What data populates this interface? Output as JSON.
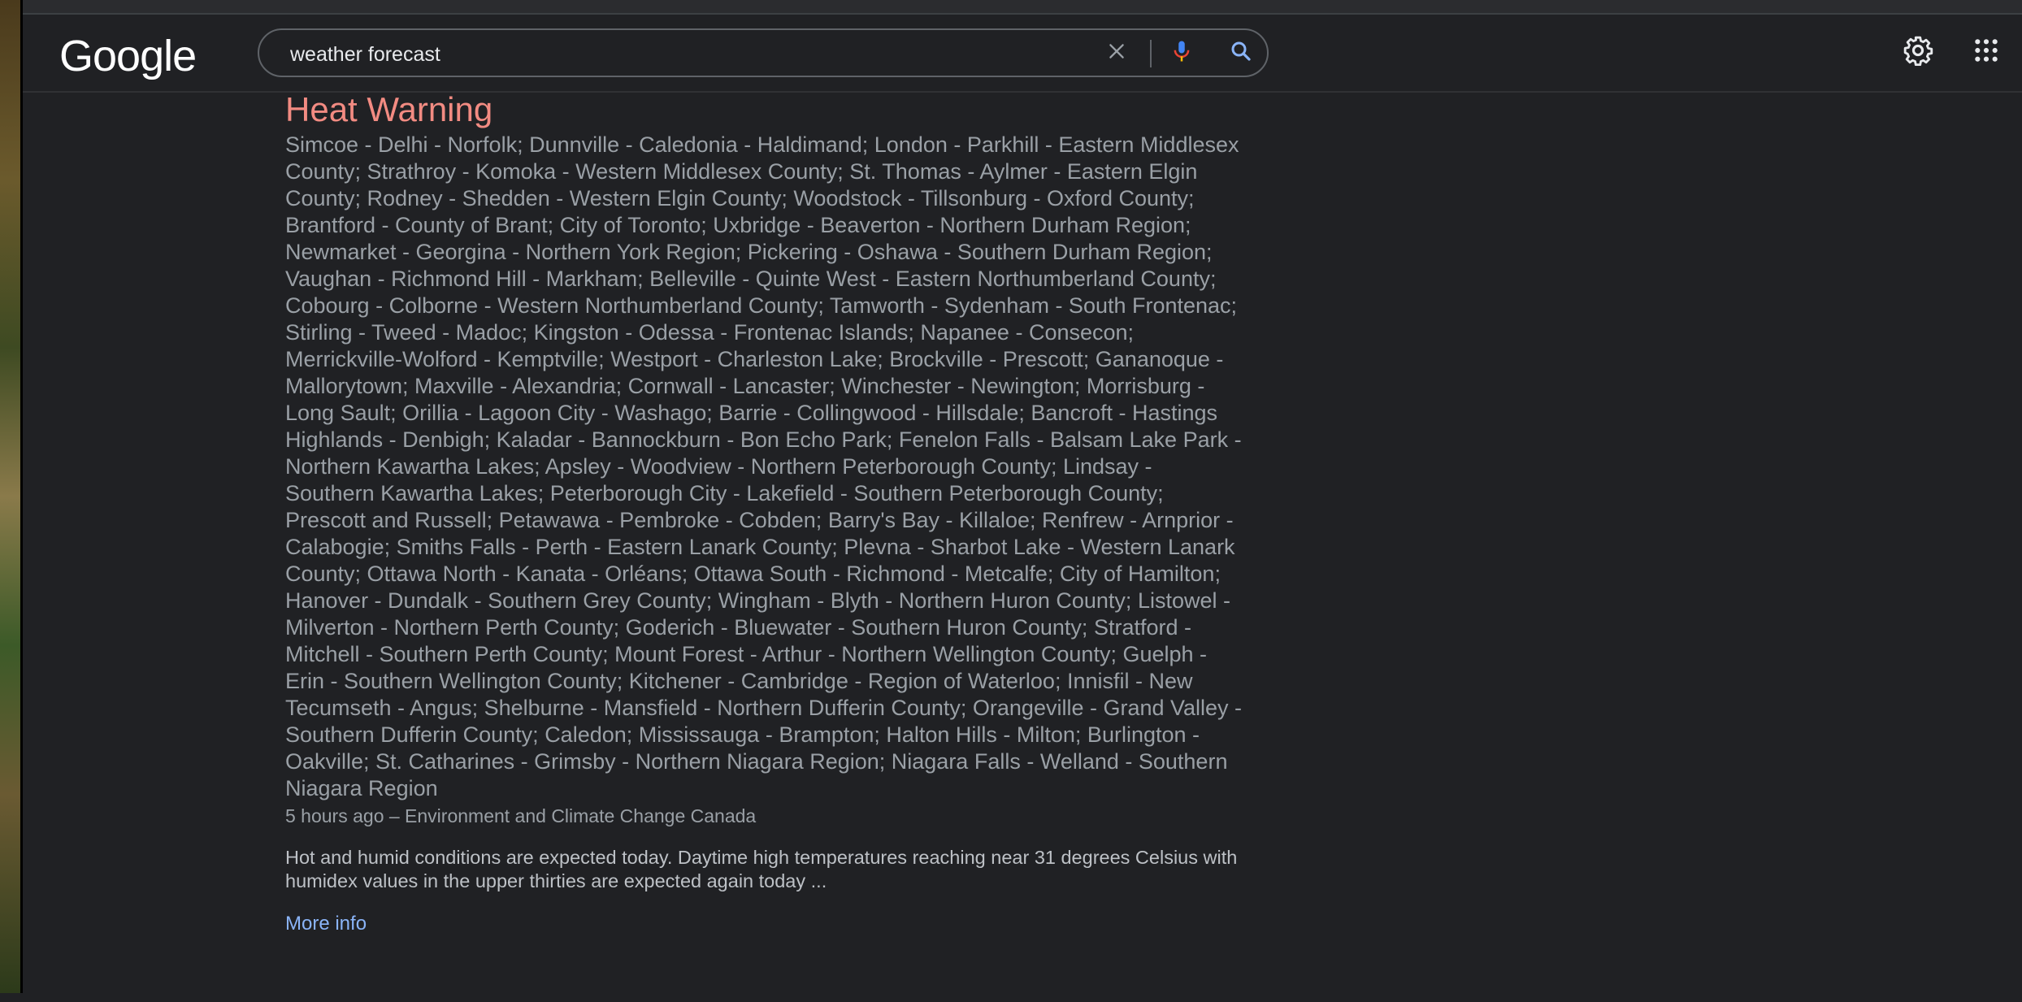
{
  "header": {
    "logo_text": "Google",
    "search_value": "weather forecast",
    "icons": [
      "close-icon",
      "mic-icon",
      "search-icon",
      "gear-icon",
      "apps-grid-icon"
    ]
  },
  "alert": {
    "title": "Heat Warning",
    "regions": "Simcoe - Delhi - Norfolk; Dunnville - Caledonia - Haldimand; London - Parkhill - Eastern Middlesex County; Strathroy - Komoka - Western Middlesex County; St. Thomas - Aylmer - Eastern Elgin County; Rodney - Shedden - Western Elgin County; Woodstock - Tillsonburg - Oxford County; Brantford - County of Brant; City of Toronto; Uxbridge - Beaverton - Northern Durham Region; Newmarket - Georgina - Northern York Region; Pickering - Oshawa - Southern Durham Region; Vaughan - Richmond Hill - Markham; Belleville - Quinte West - Eastern Northumberland County; Cobourg - Colborne - Western Northumberland County; Tamworth - Sydenham - South Frontenac; Stirling - Tweed - Madoc; Kingston - Odessa - Frontenac Islands; Napanee - Consecon; Merrickville-Wolford - Kemptville; Westport - Charleston Lake; Brockville - Prescott; Gananoque - Mallorytown; Maxville - Alexandria; Cornwall - Lancaster; Winchester - Newington; Morrisburg - Long Sault; Orillia - Lagoon City - Washago; Barrie - Collingwood - Hillsdale; Bancroft - Hastings Highlands - Denbigh; Kaladar - Bannockburn - Bon Echo Park; Fenelon Falls - Balsam Lake Park - Northern Kawartha Lakes; Apsley - Woodview - Northern Peterborough County; Lindsay - Southern Kawartha Lakes; Peterborough City - Lakefield - Southern Peterborough County; Prescott and Russell; Petawawa - Pembroke - Cobden; Barry's Bay - Killaloe; Renfrew - Arnprior - Calabogie; Smiths Falls - Perth - Eastern Lanark County; Plevna - Sharbot Lake - Western Lanark County; Ottawa North - Kanata - Orléans; Ottawa South - Richmond - Metcalfe; City of Hamilton; Hanover - Dundalk - Southern Grey County; Wingham - Blyth - Northern Huron County; Listowel - Milverton - Northern Perth County; Goderich - Bluewater - Southern Huron County; Stratford - Mitchell - Southern Perth County; Mount Forest - Arthur - Northern Wellington County; Guelph - Erin - Southern Wellington County; Kitchener - Cambridge - Region of Waterloo; Innisfil - New Tecumseth - Angus; Shelburne - Mansfield - Northern Dufferin County; Orangeville - Grand Valley - Southern Dufferin County; Caledon; Mississauga - Brampton; Halton Hills - Milton; Burlington - Oakville; St. Catharines - Grimsby - Northern Niagara Region; Niagara Falls - Welland - Southern Niagara Region",
    "meta": "5 hours ago – Environment and Climate Change Canada",
    "summary": "Hot and humid conditions are expected today. Daytime high temperatures reaching near 31 degrees Celsius with humidex values in the upper thirties are expected again today ...",
    "more_info_label": "More info"
  },
  "footer": {
    "frag_1": "",
    "frag_2": ""
  },
  "colors": {
    "background": "#202124",
    "alert_title": "#f28b82",
    "link": "#8ab4f8",
    "text_secondary": "#9aa0a6"
  }
}
